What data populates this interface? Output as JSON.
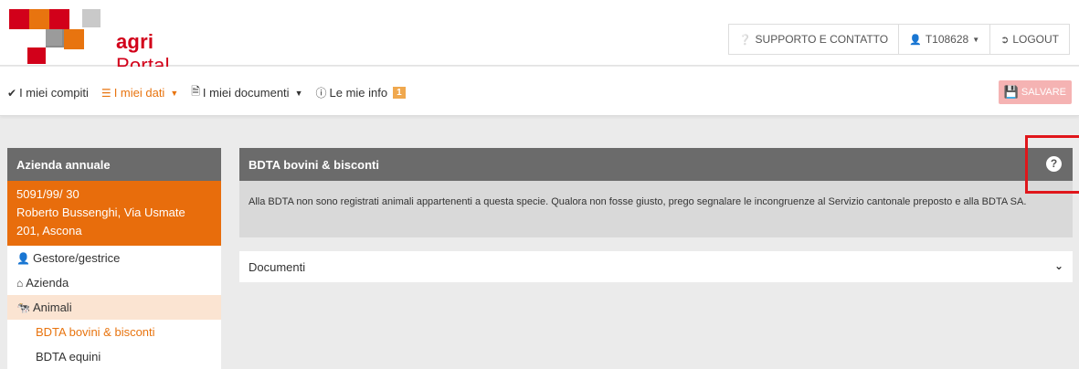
{
  "brand": {
    "name_bold": "agri",
    "name_rest": "Portal",
    "colors": {
      "red": "#d2001a",
      "grey": "#c9c9c9",
      "accent": "#e8740f"
    }
  },
  "topnav": {
    "support": {
      "icon": "question-circle-icon",
      "label": "SUPPORTO E CONTATTO"
    },
    "user": {
      "icon": "user-icon",
      "label": "T108628"
    },
    "logout": {
      "icon": "logout-icon",
      "label": "LOGOUT"
    }
  },
  "menu": {
    "items": [
      {
        "icon": "check-circle-icon",
        "label": "I miei compiti"
      },
      {
        "icon": "list-icon",
        "label": "I miei dati"
      },
      {
        "icon": "document-icon",
        "label": "I miei documenti"
      },
      {
        "icon": "info-icon",
        "label": "Le mie info",
        "badge": "1"
      }
    ],
    "save_label": "SALVARE"
  },
  "sidebar": {
    "header": "Azienda annuale",
    "org": {
      "line1": "5091/99/ 30",
      "line2": "Roberto Bussenghi, Via Usmate",
      "line3": "201, Ascona"
    },
    "items": [
      {
        "icon": "user-icon",
        "label": "Gestore/gestrice"
      },
      {
        "icon": "home-icon",
        "label": "Azienda"
      },
      {
        "icon": "cow-icon",
        "label": "Animali"
      }
    ],
    "subitems": [
      {
        "label": "BDTA bovini & bisconti"
      },
      {
        "label": "BDTA equini"
      }
    ]
  },
  "panel": {
    "title": "BDTA bovini & bisconti",
    "message": "Alla BDTA non sono registrati animali appartenenti a questa specie. Qualora non fosse giusto, prego segnalare le incongruenze al Servizio cantonale preposto e alla BDTA SA.",
    "documents_label": "Documenti"
  }
}
